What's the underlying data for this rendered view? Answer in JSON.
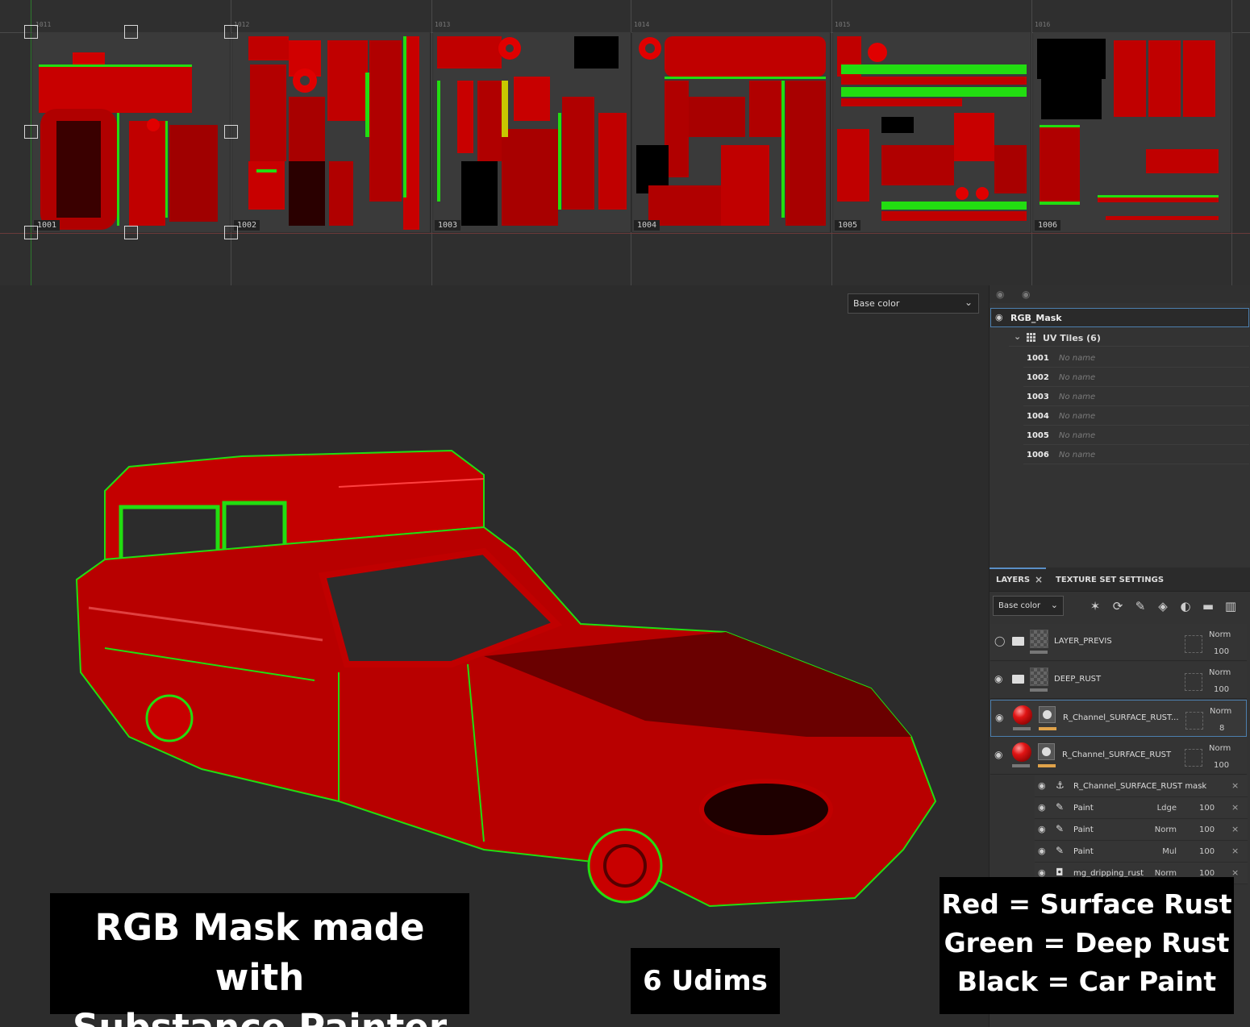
{
  "uv_editor": {
    "tiles": [
      {
        "id": "1001"
      },
      {
        "id": "1002"
      },
      {
        "id": "1003"
      },
      {
        "id": "1004"
      },
      {
        "id": "1005"
      },
      {
        "id": "1006"
      }
    ],
    "colors": {
      "red": "#e60000",
      "green": "#22dd11",
      "black": "#000000"
    }
  },
  "viewport": {
    "channel_select": "Base color"
  },
  "texture_set_list": {
    "set_name": "RGB_Mask",
    "uv_tiles_label": "UV Tiles (6)",
    "tiles": [
      {
        "num": "1001",
        "name": "No name"
      },
      {
        "num": "1002",
        "name": "No name"
      },
      {
        "num": "1003",
        "name": "No name"
      },
      {
        "num": "1004",
        "name": "No name"
      },
      {
        "num": "1005",
        "name": "No name"
      },
      {
        "num": "1006",
        "name": "No name"
      }
    ]
  },
  "layers_panel": {
    "tab_layers": "LAYERS",
    "tab_close": "×",
    "tab_texture_set": "TEXTURE SET SETTINGS",
    "channel": "Base color",
    "layers": [
      {
        "name": "LAYER_PREVIS",
        "blend": "Norm",
        "opacity": "100"
      },
      {
        "name": "DEEP_RUST",
        "blend": "Norm",
        "opacity": "100"
      },
      {
        "name": "R_Channel_SURFACE_RUST...",
        "blend": "Norm",
        "opacity": "8"
      },
      {
        "name": "R_Channel_SURFACE_RUST",
        "blend": "Norm",
        "opacity": "100"
      }
    ],
    "effects": [
      {
        "name": "R_Channel_SURFACE_RUST mask",
        "blend": "",
        "opacity": ""
      },
      {
        "name": "Paint",
        "blend": "Ldge",
        "opacity": "100"
      },
      {
        "name": "Paint",
        "blend": "Norm",
        "opacity": "100"
      },
      {
        "name": "Paint",
        "blend": "Mul",
        "opacity": "100"
      },
      {
        "name": "mg_dripping_rust",
        "blend": "Norm",
        "opacity": "100"
      }
    ]
  },
  "captions": {
    "left_line1": "RGB Mask made with",
    "left_line2": "Substance Painter",
    "middle": "6 Udims",
    "right_line1": "Red = Surface Rust",
    "right_line2": "Green = Deep Rust",
    "right_line3": "Black = Car Paint"
  }
}
